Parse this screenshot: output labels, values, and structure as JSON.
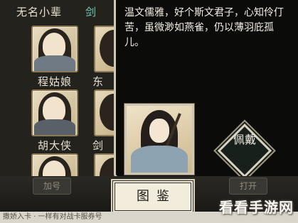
{
  "roster": {
    "names": [
      "无名小辈",
      "程姑娘",
      "胡大侠"
    ],
    "partial_names": [
      "剑",
      "东",
      "剑"
    ]
  },
  "detail": {
    "description": "温文儒雅，好个斯文君子，心知伶仃苦，虽微渺如燕雀，仍以薄羽庇孤儿。",
    "equip_label": "佩戴"
  },
  "bottom_bar": {
    "title": "图鉴",
    "left_tab": "加号",
    "right_tab": "打开",
    "ticker": "撒娇入卡 · 一样有对战卡服券号"
  },
  "watermark": "看看手游网",
  "colors": {
    "highlight_name": "#71c9b8",
    "panel_bg": "#0b0b0a",
    "frame": "#cfc6b3"
  }
}
